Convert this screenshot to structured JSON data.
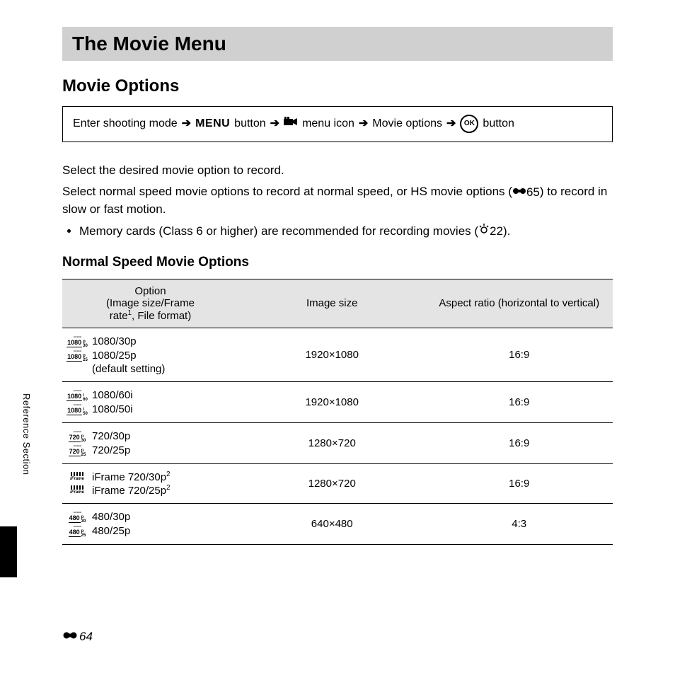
{
  "header": {
    "title": "The Movie Menu"
  },
  "section": {
    "subtitle": "Movie Options",
    "nav": {
      "start": "Enter shooting mode",
      "menu_label": "MENU",
      "button_word_1": "button",
      "menu_icon_word": "menu icon",
      "movie_options": "Movie options",
      "ok_label": "OK",
      "button_word_2": "button"
    },
    "body": {
      "p1": "Select the desired movie option to record.",
      "p2a": "Select normal speed movie options to record at normal speed, or HS movie options (",
      "p2_ref": "65",
      "p2b": ") to record in slow or fast motion.",
      "bullet1a": "Memory cards (Class 6 or higher) are recommended for recording movies (",
      "bullet1_ref": "22",
      "bullet1b": ")."
    },
    "table_title": "Normal Speed Movie Options",
    "table": {
      "headers": {
        "col1_l1": "Option",
        "col1_l2a": "(Image size/Frame",
        "col1_l2b": "rate",
        "col1_sup": "1",
        "col1_l2c": ", File format)",
        "col2": "Image size",
        "col3": "Aspect ratio (horizontal to vertical)"
      },
      "rows": [
        {
          "opts": [
            {
              "chip": {
                "num": "1080",
                "p": "p",
                "r": "30"
              },
              "label": "1080/30p"
            },
            {
              "chip": {
                "num": "1080",
                "p": "p",
                "r": "25"
              },
              "label": "1080/25p"
            }
          ],
          "note": "(default setting)",
          "size": "1920×1080",
          "ratio": "16:9"
        },
        {
          "opts": [
            {
              "chip": {
                "num": "1080",
                "p": "i",
                "r": "60"
              },
              "label": "1080/60i"
            },
            {
              "chip": {
                "num": "1080",
                "p": "i",
                "r": "50"
              },
              "label": "1080/50i"
            }
          ],
          "size": "1920×1080",
          "ratio": "16:9"
        },
        {
          "opts": [
            {
              "chip": {
                "num": "720",
                "p": "p",
                "r": "30"
              },
              "label": "720/30p"
            },
            {
              "chip": {
                "num": "720",
                "p": "p",
                "r": "25"
              },
              "label": "720/25p"
            }
          ],
          "size": "1280×720",
          "ratio": "16:9"
        },
        {
          "opts": [
            {
              "iframe": true,
              "label": "iFrame 720/30p",
              "sup": "2"
            },
            {
              "iframe": true,
              "label": "iFrame 720/25p",
              "sup": "2"
            }
          ],
          "size": "1280×720",
          "ratio": "16:9"
        },
        {
          "opts": [
            {
              "chip": {
                "num": "480",
                "p": "p",
                "r": "30"
              },
              "label": "480/30p"
            },
            {
              "chip": {
                "num": "480",
                "p": "p",
                "r": "25"
              },
              "label": "480/25p"
            }
          ],
          "size": "640×480",
          "ratio": "4:3"
        }
      ]
    }
  },
  "side_tab": "Reference Section",
  "page_number": "64"
}
